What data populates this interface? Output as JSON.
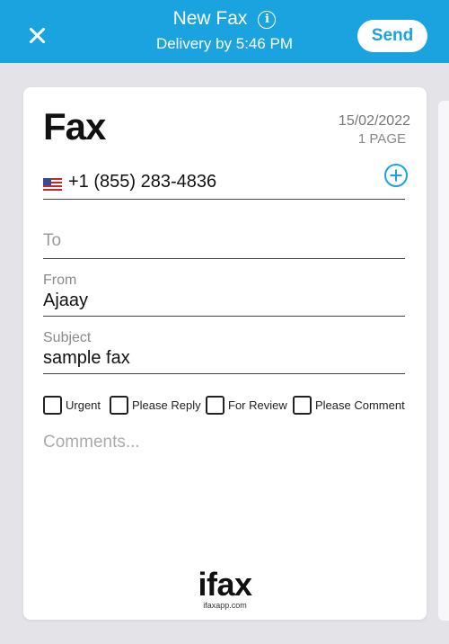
{
  "header": {
    "title": "New Fax",
    "subtitle": "Delivery by 5:46 PM",
    "send_label": "Send",
    "info_icon_glyph": "i",
    "accent_color": "#1ba3e0"
  },
  "cover": {
    "title": "Fax",
    "date": "15/02/2022",
    "pages": "1 PAGE",
    "recipient": {
      "country_flag": "US",
      "number": "+1 (855) 283-4836"
    },
    "to_placeholder": "To",
    "from_label": "From",
    "from_value": "Ajaay",
    "subject_label": "Subject",
    "subject_value": "sample fax",
    "checkboxes": [
      {
        "label": "Urgent",
        "checked": false
      },
      {
        "label": "Please Reply",
        "checked": false
      },
      {
        "label": "For Review",
        "checked": false
      },
      {
        "label": "Please Comment",
        "checked": false
      }
    ],
    "comments_placeholder": "Comments...",
    "logo": "ifax",
    "logo_url": "ifaxapp.com"
  },
  "icons": [
    "close-icon",
    "info-icon",
    "us-flag-icon",
    "add-circle-icon"
  ]
}
